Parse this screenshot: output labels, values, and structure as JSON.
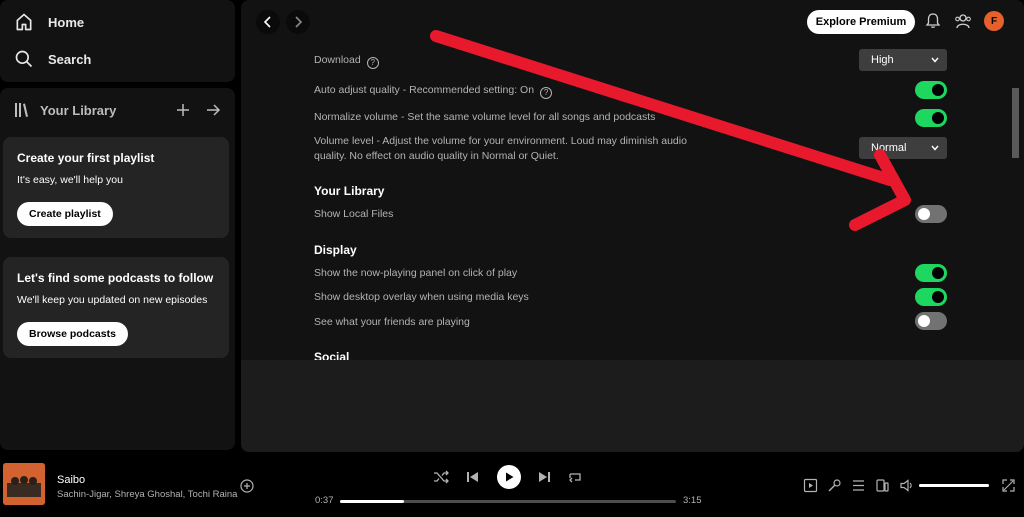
{
  "nav": {
    "home": "Home",
    "search": "Search"
  },
  "library": {
    "title": "Your Library",
    "card_playlist": {
      "heading": "Create your first playlist",
      "text": "It's easy, we'll help you",
      "button": "Create playlist"
    },
    "card_podcasts": {
      "heading": "Let's find some podcasts to follow",
      "text": "We'll keep you updated on new episodes",
      "button": "Browse podcasts"
    }
  },
  "topbar": {
    "premium": "Explore Premium",
    "avatar_letter": "F"
  },
  "settings": {
    "download_label": "Download",
    "download_value": "High",
    "auto_adjust": "Auto adjust quality - Recommended setting: On",
    "normalize": "Normalize volume - Set the same volume level for all songs and podcasts",
    "volume_level_line1": "Volume level - Adjust the volume for your environment. Loud may diminish audio",
    "volume_level_line2": "quality. No effect on audio quality in Normal or Quiet.",
    "volume_level_value": "Normal",
    "your_library_title": "Your Library",
    "show_local_files": "Show Local Files",
    "display_title": "Display",
    "now_playing_panel": "Show the now-playing panel on click of play",
    "desktop_overlay": "Show desktop overlay when using media keys",
    "friends_playing": "See what your friends are playing",
    "social_title": "Social",
    "toggles": {
      "auto_adjust": true,
      "normalize": true,
      "show_local_files": false,
      "now_playing_panel": true,
      "desktop_overlay": true,
      "friends_playing": false
    }
  },
  "player": {
    "title": "Saibo",
    "artists": "Sachin-Jigar, Shreya Ghoshal, Tochi Raina",
    "elapsed": "0:37",
    "duration": "3:15",
    "progress_fraction": 0.19,
    "volume_fraction": 1.0
  },
  "colors": {
    "accent_green": "#1ed760",
    "annotation_red": "#e8192c"
  }
}
